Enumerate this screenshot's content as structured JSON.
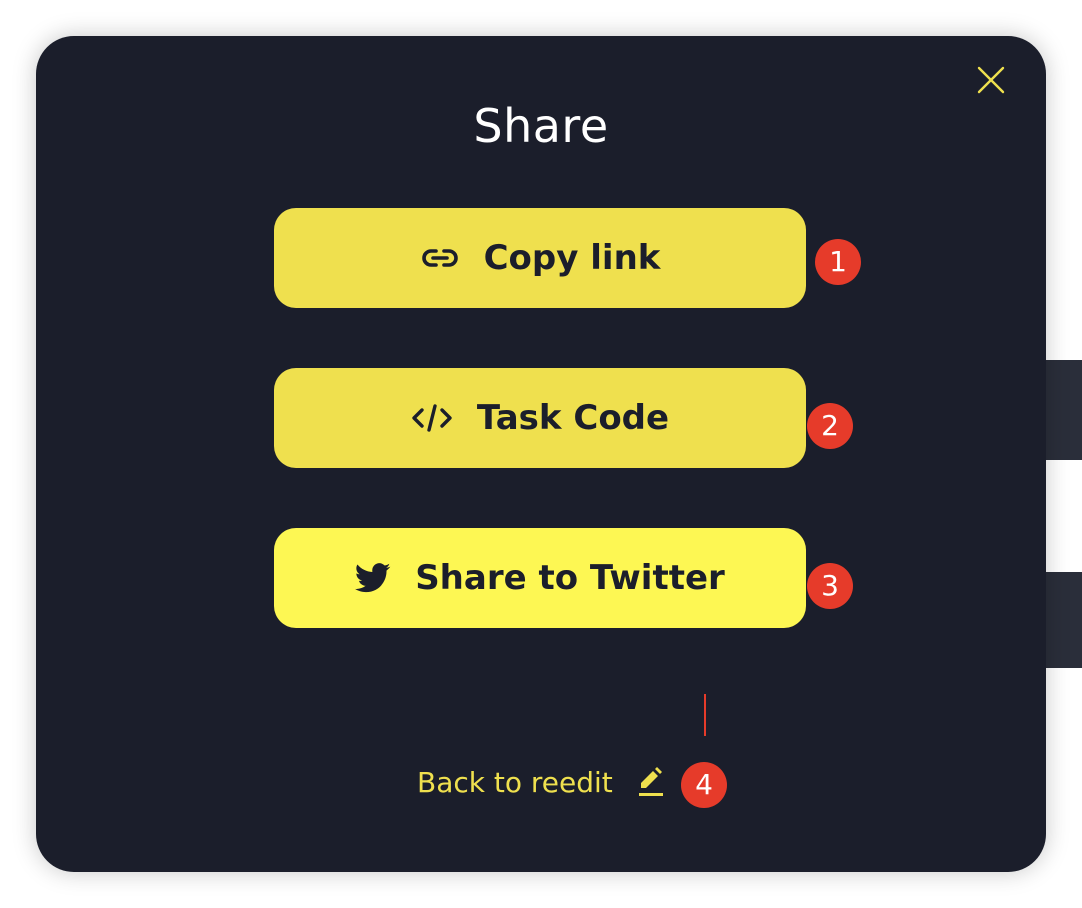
{
  "modal": {
    "title": "Share",
    "close_icon": "close-icon",
    "accent_color": "#efe04e",
    "background_color": "#1b1e2b"
  },
  "actions": [
    {
      "label": "Copy link",
      "icon": "link-icon",
      "badge": "1"
    },
    {
      "label": "Task Code",
      "icon": "code-icon",
      "badge": "2"
    },
    {
      "label": "Share to Twitter",
      "icon": "twitter-icon",
      "badge": "3"
    }
  ],
  "back_link": {
    "label": "Back to reedit",
    "icon": "pencil-icon",
    "badge": "4"
  },
  "colors": {
    "button_yellow": "#efe04e",
    "twitter_button_yellow": "#fdf753",
    "annotation_red": "#e63b2a"
  }
}
